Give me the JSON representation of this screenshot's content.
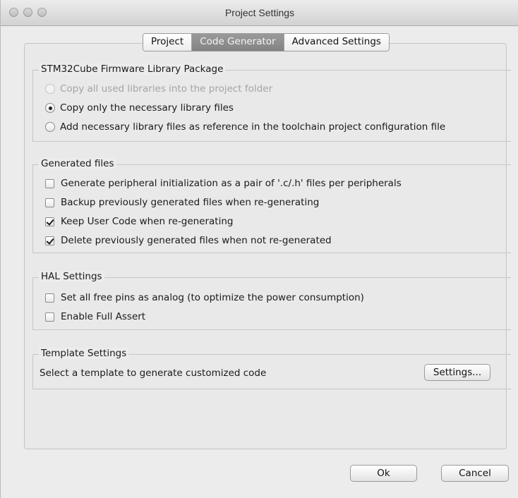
{
  "window": {
    "title": "Project Settings"
  },
  "tabs": [
    {
      "label": "Project",
      "active": false
    },
    {
      "label": "Code Generator",
      "active": true
    },
    {
      "label": "Advanced Settings",
      "active": false
    }
  ],
  "firmware_group": {
    "title": "STM32Cube Firmware Library Package",
    "options": [
      {
        "label": "Copy all used libraries into the project folder",
        "selected": false,
        "disabled": true
      },
      {
        "label": "Copy only the necessary library files",
        "selected": true,
        "disabled": false
      },
      {
        "label": "Add necessary library files as reference in the toolchain project configuration file",
        "selected": false,
        "disabled": false
      }
    ]
  },
  "generated_group": {
    "title": "Generated files",
    "options": [
      {
        "label": "Generate peripheral initialization as a pair of '.c/.h' files per peripherals",
        "checked": false
      },
      {
        "label": "Backup previously generated files when re-generating",
        "checked": false
      },
      {
        "label": "Keep User Code when re-generating",
        "checked": true
      },
      {
        "label": "Delete previously generated files when not re-generated",
        "checked": true
      }
    ]
  },
  "hal_group": {
    "title": "HAL Settings",
    "options": [
      {
        "label": "Set all free pins as analog (to optimize the power consumption)",
        "checked": false
      },
      {
        "label": "Enable Full Assert",
        "checked": false
      }
    ]
  },
  "template_group": {
    "title": "Template Settings",
    "description": "Select a template to generate customized code",
    "button_label": "Settings..."
  },
  "footer": {
    "ok_label": "Ok",
    "cancel_label": "Cancel"
  }
}
